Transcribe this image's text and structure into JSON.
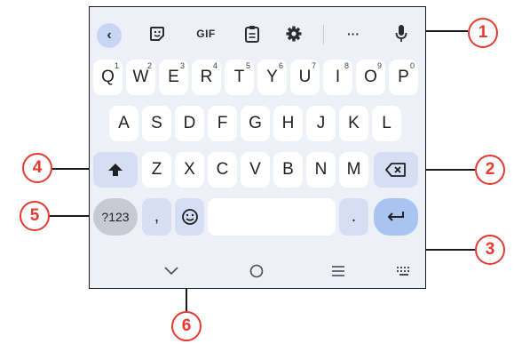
{
  "toolbar": {
    "gif_label": "GIF",
    "more_label": "···"
  },
  "keys": {
    "row1": [
      {
        "label": "Q",
        "hint": "1"
      },
      {
        "label": "W",
        "hint": "2"
      },
      {
        "label": "E",
        "hint": "3"
      },
      {
        "label": "R",
        "hint": "4"
      },
      {
        "label": "T",
        "hint": "5"
      },
      {
        "label": "Y",
        "hint": "6"
      },
      {
        "label": "U",
        "hint": "7"
      },
      {
        "label": "I",
        "hint": "8"
      },
      {
        "label": "O",
        "hint": "9"
      },
      {
        "label": "P",
        "hint": "0"
      }
    ],
    "row2": [
      "A",
      "S",
      "D",
      "F",
      "G",
      "H",
      "J",
      "K",
      "L"
    ],
    "row3": [
      "Z",
      "X",
      "C",
      "V",
      "B",
      "N",
      "M"
    ],
    "num_key": "?123",
    "comma": ",",
    "period": "."
  },
  "callouts": [
    "1",
    "2",
    "3",
    "4",
    "5",
    "6"
  ],
  "icons": {
    "back": "chevron-left-icon",
    "sticker": "sticker-icon",
    "clipboard": "clipboard-icon",
    "settings": "gear-icon",
    "mic": "microphone-icon",
    "shift": "shift-icon",
    "backspace": "backspace-icon",
    "emoji": "emoji-icon",
    "enter": "enter-icon",
    "nav_down": "chevron-down-icon",
    "nav_home": "home-circle-icon",
    "nav_menu": "menu-icon",
    "nav_keyboard": "keyboard-icon"
  },
  "colors": {
    "keyboard_bg": "#eef0f7",
    "function_key": "#d5def3",
    "enter_key": "#a8c5f1",
    "callout_red": "#e53a30"
  }
}
